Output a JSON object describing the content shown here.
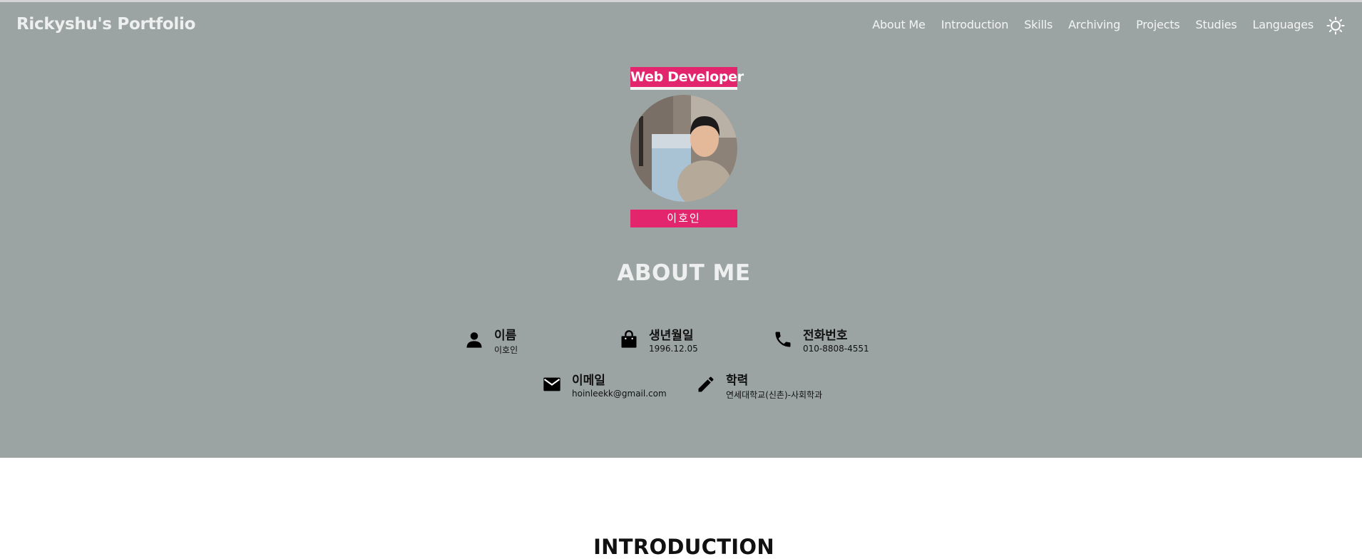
{
  "brand": "Rickyshu's Portfolio",
  "nav": {
    "items": [
      "About Me",
      "Introduction",
      "Skills",
      "Archiving",
      "Projects",
      "Studies",
      "Languages"
    ],
    "theme_toggle_icon": "sun-icon"
  },
  "hero": {
    "role": "Web Developer",
    "name": "이호인",
    "avatar_icon": "profile-photo"
  },
  "about": {
    "title": "ABOUT ME",
    "items": [
      {
        "icon": "person-icon",
        "label": "이름",
        "value": "이호인"
      },
      {
        "icon": "calendar-bag-icon",
        "label": "생년월일",
        "value": "1996.12.05"
      },
      {
        "icon": "phone-icon",
        "label": "전화번호",
        "value": "010-8808-4551"
      },
      {
        "icon": "mail-icon",
        "label": "이메일",
        "value": "hoinleekk@gmail.com"
      },
      {
        "icon": "pencil-icon",
        "label": "학력",
        "value": "연세대학교(신촌)-사회학과"
      }
    ]
  },
  "introduction": {
    "title": "INTRODUCTION"
  },
  "colors": {
    "hero_bg": "#9ba4a2",
    "accent": "#e3256e"
  }
}
